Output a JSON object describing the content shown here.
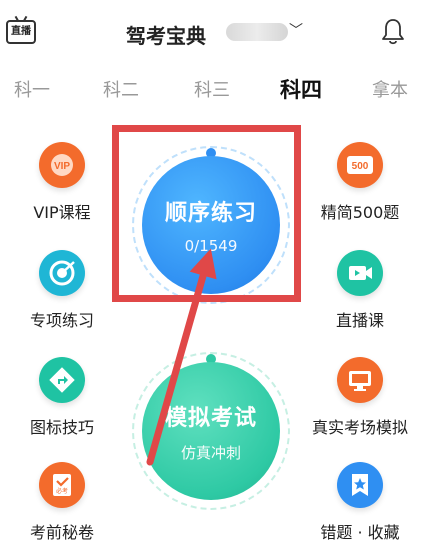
{
  "header": {
    "live_label": "直播",
    "app_title": "驾考宝典"
  },
  "tabs": [
    {
      "label": "科一"
    },
    {
      "label": "科二"
    },
    {
      "label": "科三"
    },
    {
      "label": "科四"
    },
    {
      "label": "拿本"
    }
  ],
  "left_items": [
    {
      "label": "VIP课程",
      "icon": "vip-icon",
      "badge": "VIP"
    },
    {
      "label": "专项练习",
      "icon": "target-icon"
    },
    {
      "label": "图标技巧",
      "icon": "traffic-sign-icon"
    },
    {
      "label": "考前秘卷",
      "icon": "exam-paper-icon",
      "badge": "必考"
    }
  ],
  "right_items": [
    {
      "label": "精简500题",
      "icon": "500-questions-icon",
      "badge": "500"
    },
    {
      "label": "直播课",
      "icon": "video-play-icon"
    },
    {
      "label": "真实考场模拟",
      "icon": "monitor-icon"
    },
    {
      "label": "错题 · 收藏",
      "icon": "star-bookmark-icon"
    }
  ],
  "practice": {
    "title": "顺序练习",
    "progress": "0/1549"
  },
  "mock": {
    "title": "模拟考试",
    "subtitle": "仿真冲刺"
  },
  "colors": {
    "practice_blue": "#2f8ff2",
    "mock_green": "#2ec9a4",
    "highlight_red": "#e04848",
    "orange": "#f36b2c",
    "cyan": "#1fb6d5",
    "teal": "#1fc3a3"
  }
}
